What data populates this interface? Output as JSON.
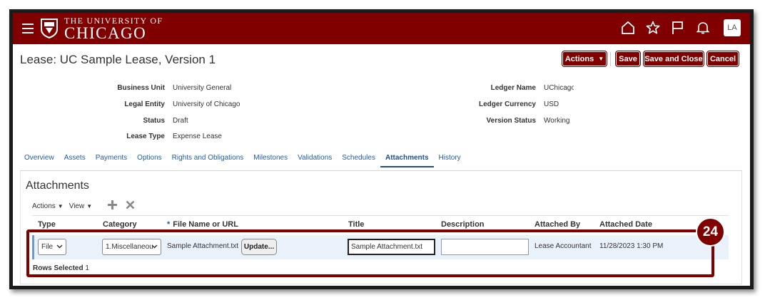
{
  "header": {
    "logo_line1": "THE UNIVERSITY OF",
    "logo_line2": "CHICAGO",
    "avatar": "LA",
    "icons": [
      "menu-icon",
      "home-icon",
      "star-icon",
      "flag-icon",
      "bell-icon"
    ]
  },
  "page": {
    "title": "Lease: UC Sample Lease, Version 1",
    "actions_label": "Actions",
    "save_label": "Save",
    "save_close_label": "Save and Close",
    "cancel_label": "Cancel"
  },
  "details": {
    "business_unit_label": "Business Unit",
    "business_unit": "University General",
    "legal_entity_label": "Legal Entity",
    "legal_entity": "University of Chicago",
    "status_label": "Status",
    "status": "Draft",
    "lease_type_label": "Lease Type",
    "lease_type": "Expense Lease",
    "ledger_name_label": "Ledger Name",
    "ledger_name": "UChicago",
    "ledger_currency_label": "Ledger Currency",
    "ledger_currency": "USD",
    "version_status_label": "Version Status",
    "version_status": "Working"
  },
  "tabs": [
    "Overview",
    "Assets",
    "Payments",
    "Options",
    "Rights and Obligations",
    "Milestones",
    "Validations",
    "Schedules",
    "Attachments",
    "History"
  ],
  "active_tab": "Attachments",
  "attachments": {
    "title": "Attachments",
    "actions_menu": "Actions",
    "view_menu": "View",
    "columns": {
      "type": "Type",
      "category": "Category",
      "required_mark": "*",
      "file": "File Name or URL",
      "title": "Title",
      "description": "Description",
      "attached_by": "Attached By",
      "attached_date": "Attached Date"
    },
    "row": {
      "type": "File",
      "category": "1.Miscellaneous",
      "file_name": "Sample Attachment.txt",
      "update_label": "Update...",
      "title": "Sample Attachment.txt",
      "description": "",
      "attached_by": "Lease Accountant",
      "attached_date": "11/28/2023 1:30 PM"
    },
    "rows_selected_label": "Rows Selected",
    "rows_selected_count": "1"
  },
  "callout": "24",
  "colors": {
    "brand": "#800000",
    "link": "#1f5ba8",
    "row_highlight": "#e9f1fb"
  }
}
